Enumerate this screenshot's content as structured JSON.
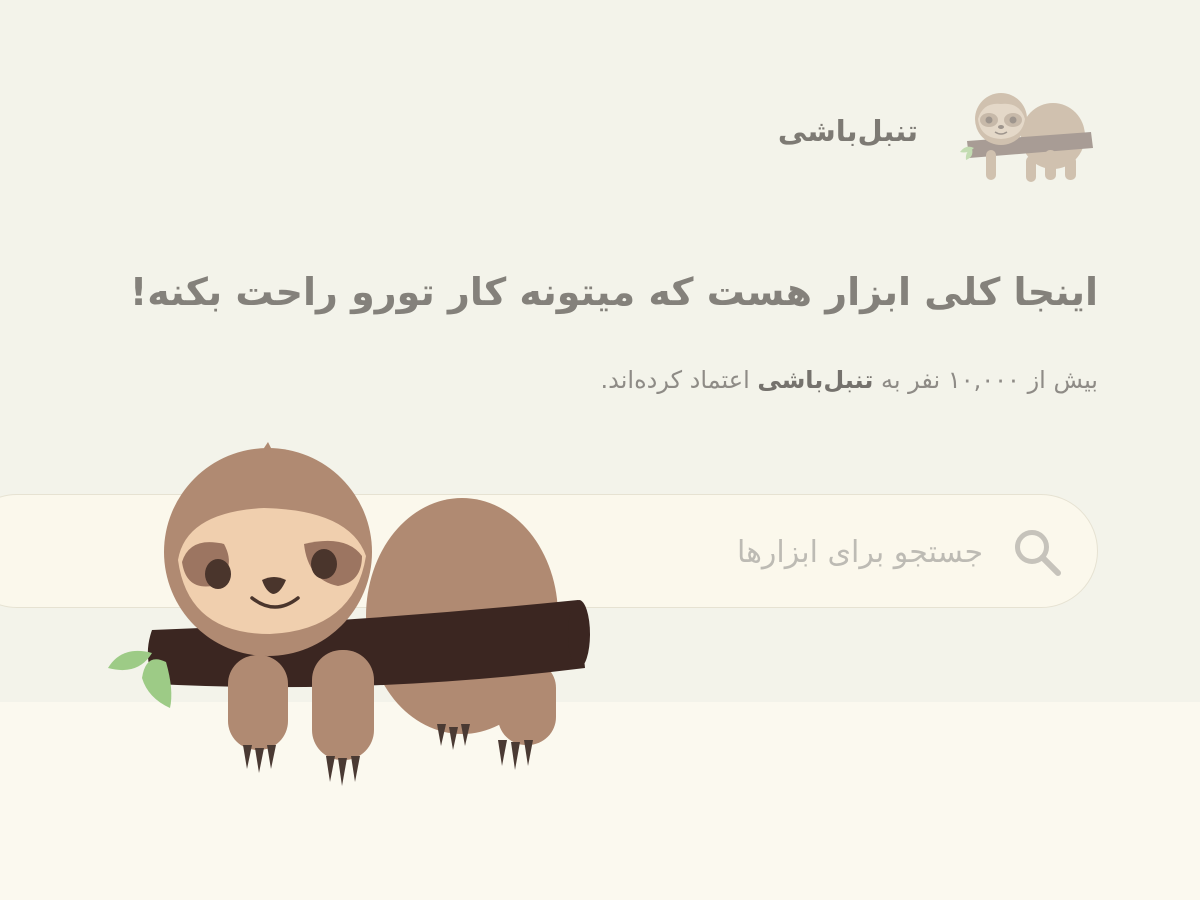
{
  "brand": {
    "name": "تنبل‌باشی",
    "logo_icon": "sloth-logo-icon"
  },
  "hero": {
    "headline": "اینجا کلی ابزار هست که میتونه کار تورو راحت بکنه!",
    "subline": {
      "prefix": "بیش از ۱۰,۰۰۰ نفر به",
      "brand": "تنبل‌باشی",
      "suffix": "اعتماد کرده‌اند."
    }
  },
  "search": {
    "placeholder": "جستجو برای ابزارها",
    "value": "",
    "icon": "search-icon"
  },
  "mascot": {
    "icon": "sloth-mascot-illustration"
  },
  "colors": {
    "hero_background": "#f3f3ea",
    "page_background": "#fbf9ef",
    "text_muted": "#84817b",
    "sloth_fur": "#b08a72",
    "sloth_face": "#f0cfae",
    "branch": "#3b2621",
    "leaf": "#9dcb86"
  }
}
